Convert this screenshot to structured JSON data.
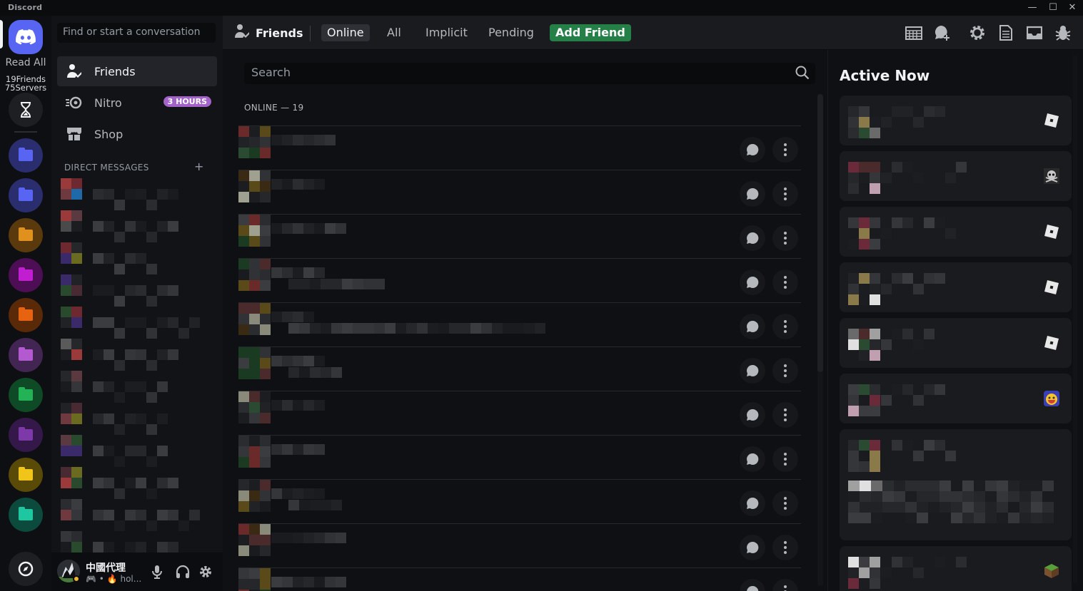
{
  "window": {
    "brand": "Discord",
    "controls": [
      "minimize",
      "maximize",
      "close"
    ]
  },
  "rail": {
    "read_all": "Read All",
    "friends_count": "19Friends",
    "servers_count": "75Servers",
    "folders": [
      {
        "color": "#5865f2",
        "bg": "#2a2e6e"
      },
      {
        "color": "#5865f2",
        "bg": "#2a2e6e"
      },
      {
        "color": "#e0901c",
        "bg": "#5a3a0d"
      },
      {
        "color": "#c21ed1",
        "bg": "#4e0e55"
      },
      {
        "color": "#e8630f",
        "bg": "#5a2a08"
      },
      {
        "color": "#b35ad1",
        "bg": "#432554"
      },
      {
        "color": "#23b356",
        "bg": "#0f4a26"
      },
      {
        "color": "#7e39a8",
        "bg": "#35184a"
      },
      {
        "color": "#f0c418",
        "bg": "#5a4a08"
      },
      {
        "color": "#1ec7a0",
        "bg": "#0b4a3c"
      }
    ]
  },
  "sidebar": {
    "search_placeholder": "Find or start a conversation",
    "nav": {
      "friends": "Friends",
      "nitro": "Nitro",
      "nitro_badge": "3 HOURS",
      "shop": "Shop"
    },
    "dm_header": "DIRECT MESSAGES",
    "dm_add": "+"
  },
  "user": {
    "name": "中國代理",
    "status_text": "hol..."
  },
  "header": {
    "title": "Friends",
    "tabs": {
      "online": "Online",
      "all": "All",
      "implicit": "Implicit",
      "pending": "Pending",
      "add_friend": "Add Friend"
    }
  },
  "main": {
    "search_placeholder": "Search",
    "online_label": "ONLINE — 19"
  },
  "active_now": {
    "title": "Active Now"
  },
  "colors": {
    "brand": "#5865f2",
    "add_friend": "#248046",
    "nitro": "#a463c9",
    "idle": "#f0b232"
  }
}
